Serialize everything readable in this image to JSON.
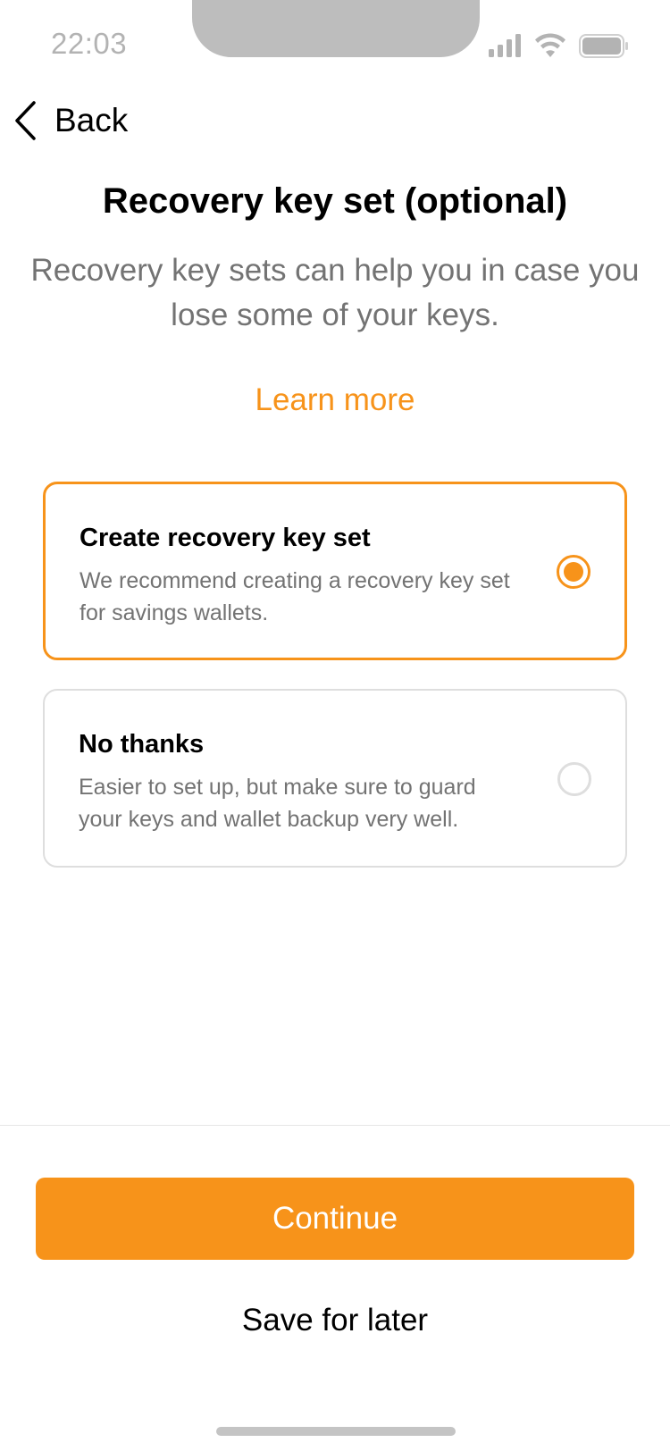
{
  "status_bar": {
    "time": "22:03",
    "icons": [
      "signal-icon",
      "wifi-icon",
      "battery-icon"
    ]
  },
  "nav": {
    "back_label": "Back",
    "back_icon": "chevron-left-icon"
  },
  "page": {
    "title": "Recovery key set (optional)",
    "subtitle": "Recovery key sets can help you in case you lose some of your keys.",
    "learn_more": "Learn more"
  },
  "options": [
    {
      "title": "Create recovery key set",
      "description": "We recommend creating a recovery key set for savings wallets.",
      "selected": true
    },
    {
      "title": "No thanks",
      "description": "Easier to set up, but make sure to guard your keys and wallet backup very well.",
      "selected": false
    }
  ],
  "footer": {
    "continue_label": "Continue",
    "save_later_label": "Save for later"
  },
  "colors": {
    "accent": "#f7931a",
    "muted_text": "#737373",
    "border": "#dedede"
  }
}
